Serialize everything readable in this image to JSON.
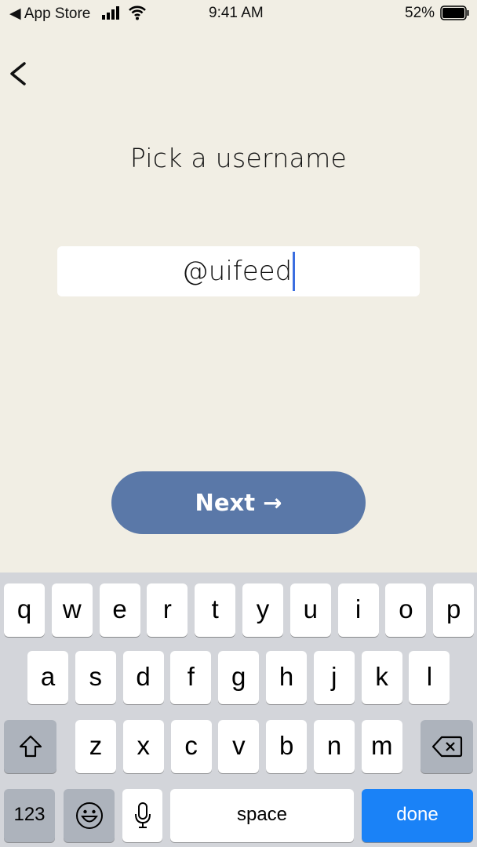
{
  "status_bar": {
    "back_app": "◀ App Store",
    "time": "9:41 AM",
    "battery": "52%",
    "icons": [
      "signal-icon",
      "wifi-icon",
      "battery-icon"
    ]
  },
  "header": {
    "back_icon": "chevron-left-icon",
    "title": "Pick a username"
  },
  "username_input": {
    "value": "@uifeed"
  },
  "next_button": {
    "label": "Next →",
    "color": "#5a78a8"
  },
  "keyboard": {
    "row1": [
      "q",
      "w",
      "e",
      "r",
      "t",
      "y",
      "u",
      "i",
      "o",
      "p"
    ],
    "row2": [
      "a",
      "s",
      "d",
      "f",
      "g",
      "h",
      "j",
      "k",
      "l"
    ],
    "row3": [
      "z",
      "x",
      "c",
      "v",
      "b",
      "n",
      "m"
    ],
    "numbers_label": "123",
    "space_label": "space",
    "done_label": "done",
    "done_color": "#1a82f7"
  }
}
